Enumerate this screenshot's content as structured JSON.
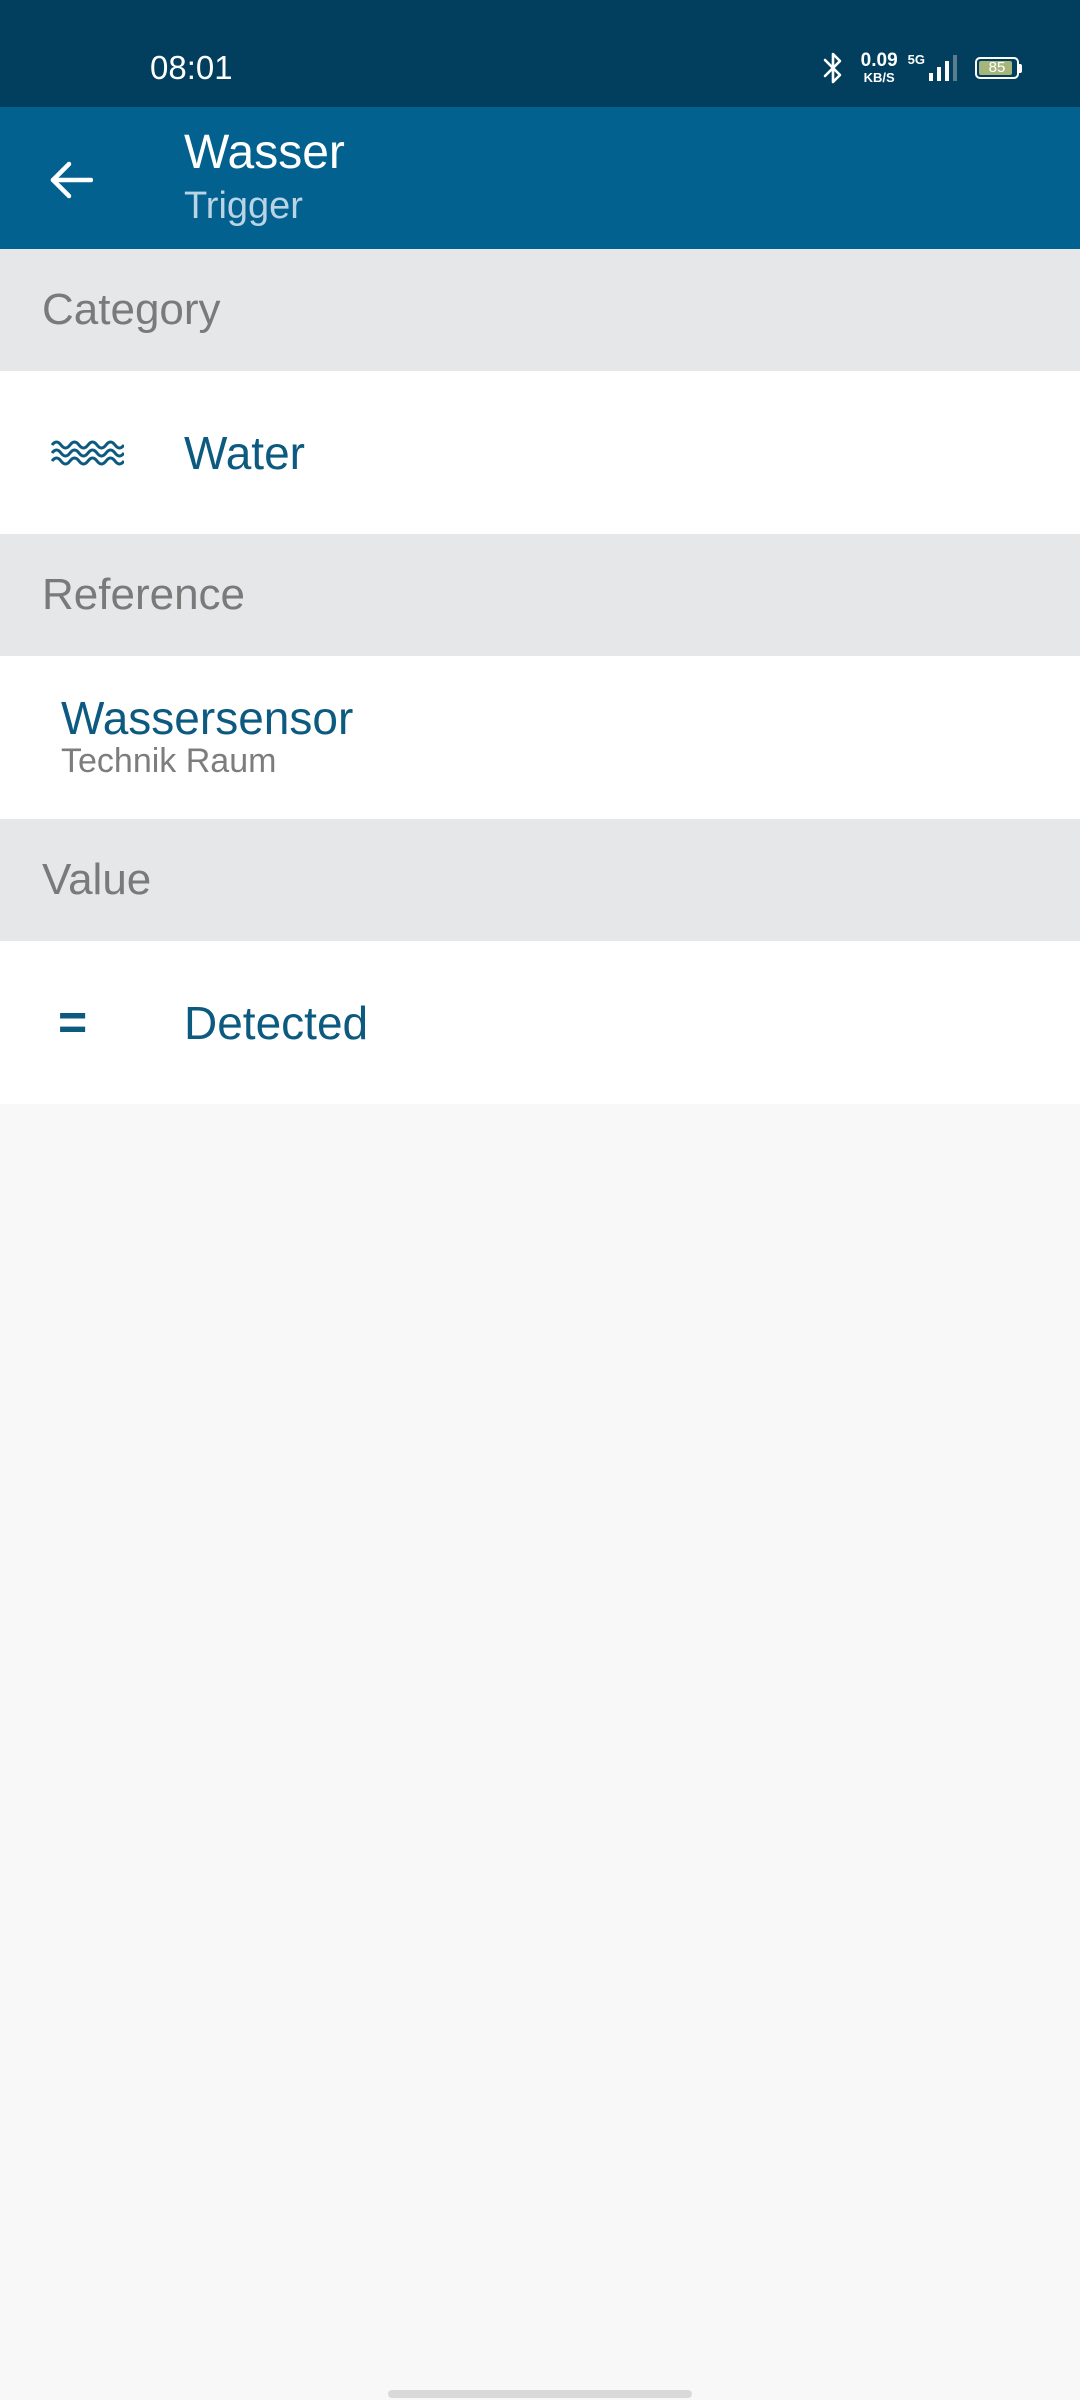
{
  "status_bar": {
    "time": "08:01",
    "net_speed_value": "0.09",
    "net_speed_unit": "KB/S",
    "network_type": "5G",
    "battery_level": "85",
    "bluetooth_icon": "bluetooth-icon",
    "signal_icon": "signal-icon"
  },
  "app_bar": {
    "title": "Wasser",
    "subtitle": "Trigger",
    "back_icon": "arrow-back-icon"
  },
  "sections": {
    "category": {
      "header": "Category",
      "value": "Water",
      "icon": "water-waves-icon"
    },
    "reference": {
      "header": "Reference",
      "title": "Wassersensor",
      "subtitle": "Technik Raum"
    },
    "value": {
      "header": "Value",
      "operator_symbol": "=",
      "value": "Detected"
    }
  },
  "colors": {
    "status_bar": "#023f5e",
    "app_bar": "#02618f",
    "accent_text": "#0c5a80",
    "section_header_bg": "#e5e7e8",
    "background": "#f8f8f8"
  }
}
